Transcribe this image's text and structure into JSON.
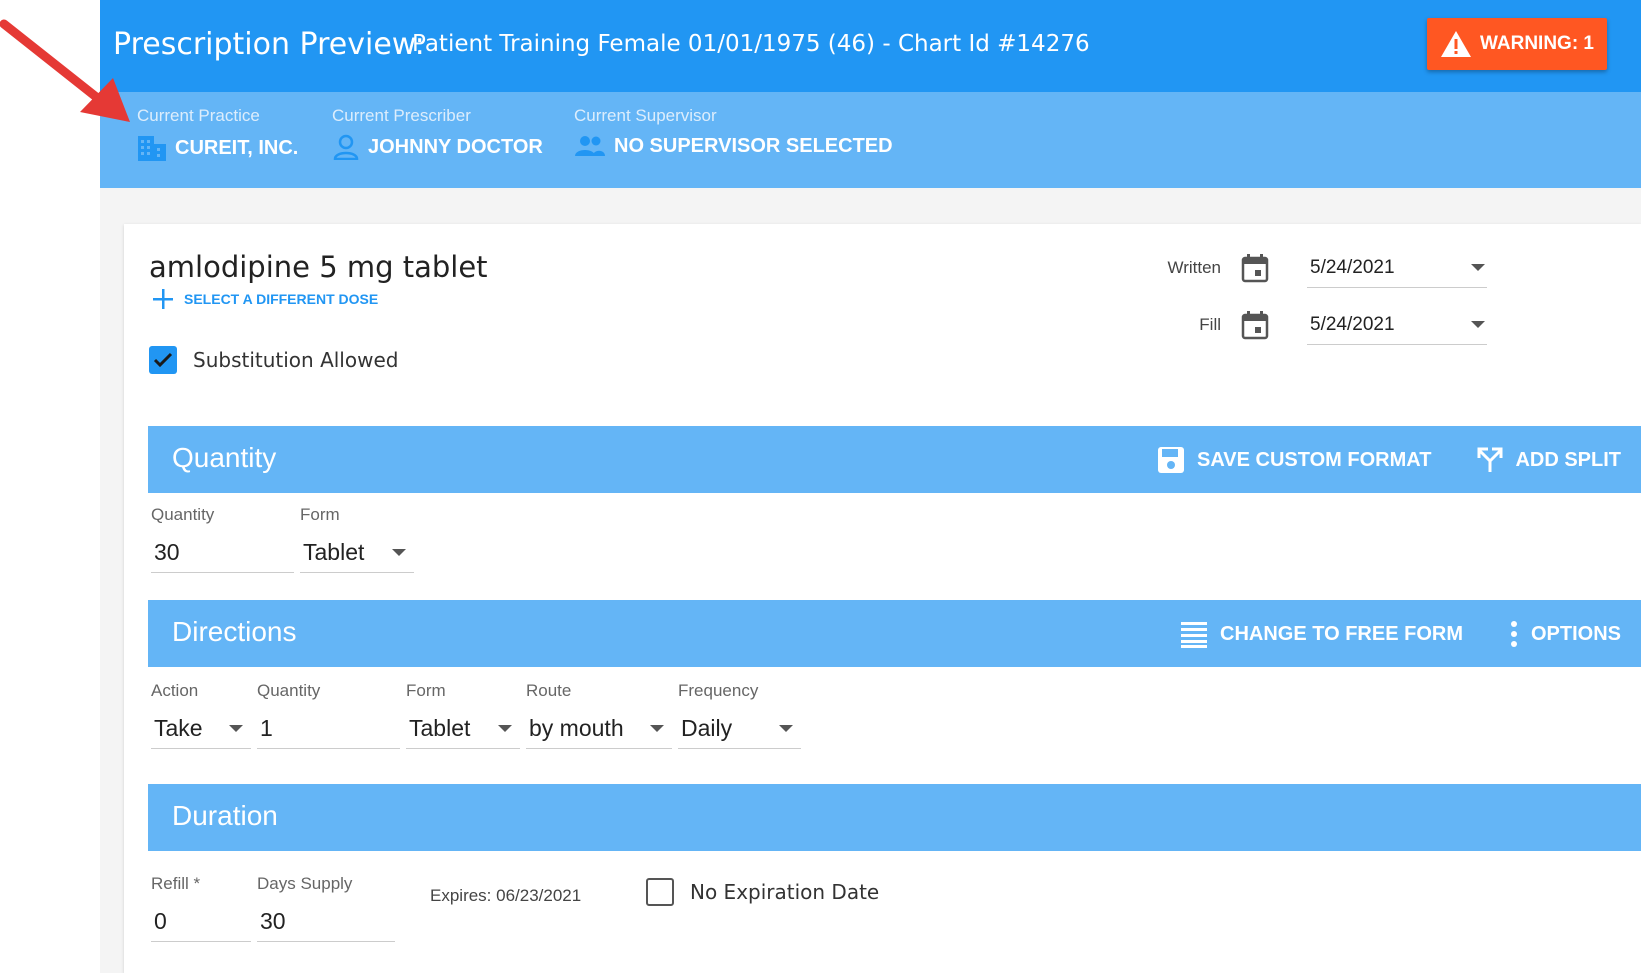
{
  "header": {
    "title": "Prescription Preview:",
    "patient": "Patient Training Female 01/01/1975 (46) - Chart Id #14276",
    "warning_label": "WARNING: 1"
  },
  "context": {
    "practice_label": "Current Practice",
    "practice_value": "CUREIT, INC.",
    "prescriber_label": "Current Prescriber",
    "prescriber_value": "JOHNNY DOCTOR",
    "supervisor_label": "Current Supervisor",
    "supervisor_value": "NO SUPERVISOR SELECTED"
  },
  "drug": {
    "name": "amlodipine 5 mg tablet",
    "select_dose": "SELECT A DIFFERENT DOSE",
    "substitution_label": "Substitution Allowed",
    "substitution_checked": true
  },
  "dates": {
    "written_label": "Written",
    "written_value": "5/24/2021",
    "fill_label": "Fill",
    "fill_value": "5/24/2021"
  },
  "quantity": {
    "title": "Quantity",
    "save_custom_format": "SAVE CUSTOM FORMAT",
    "add_split": "ADD SPLIT",
    "quantity_label": "Quantity",
    "quantity_value": "30",
    "form_label": "Form",
    "form_value": "Tablet"
  },
  "directions": {
    "title": "Directions",
    "change_free_form": "CHANGE TO FREE FORM",
    "options": "OPTIONS",
    "action_label": "Action",
    "action_value": "Take",
    "quantity_label": "Quantity",
    "quantity_value": "1",
    "form_label": "Form",
    "form_value": "Tablet",
    "route_label": "Route",
    "route_value": "by mouth",
    "frequency_label": "Frequency",
    "frequency_value": "Daily"
  },
  "duration": {
    "title": "Duration",
    "refill_label": "Refill *",
    "refill_value": "0",
    "days_supply_label": "Days Supply",
    "days_supply_value": "30",
    "expires": "Expires: 06/23/2021",
    "no_expiration_label": "No Expiration Date",
    "no_expiration_checked": false
  },
  "colors": {
    "primary": "#2196f3",
    "section": "#64b5f6",
    "warning": "#ff5722",
    "annotation_arrow": "#e53935"
  }
}
